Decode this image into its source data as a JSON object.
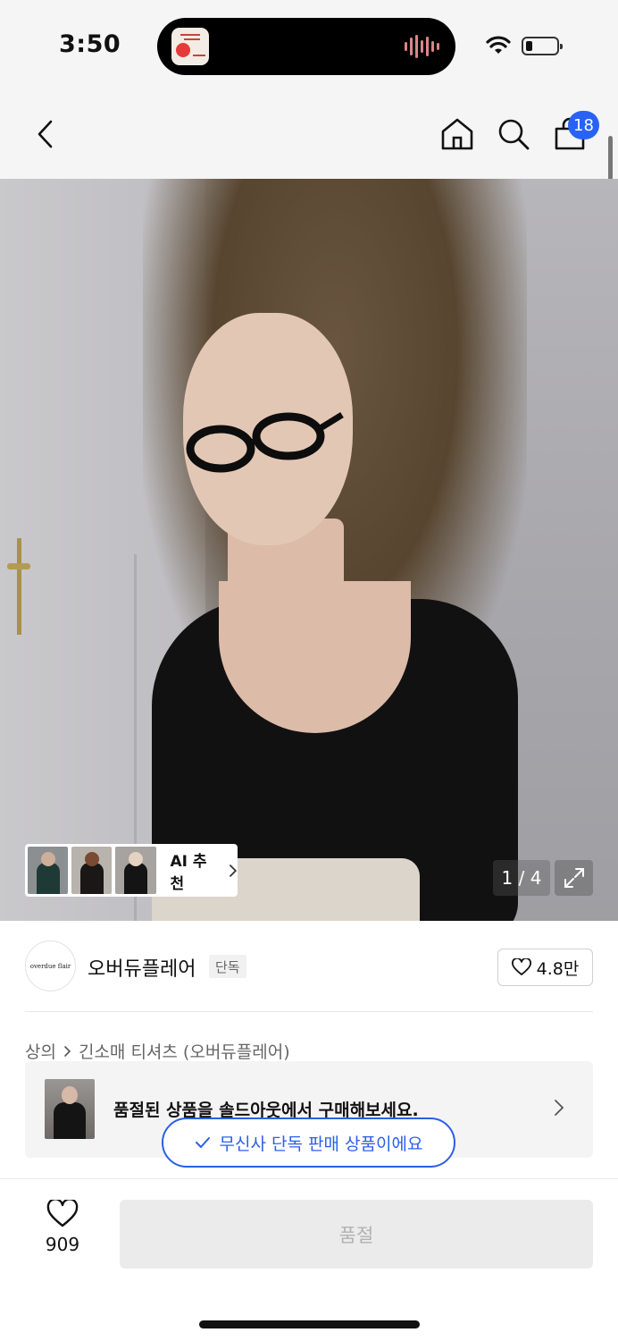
{
  "status_bar": {
    "time": "3:50"
  },
  "header": {
    "cart_count": "18"
  },
  "product_image": {
    "counter": "1 / 4",
    "ai_recommend_label": "AI 추천"
  },
  "brand": {
    "logo_text": "overdue flair",
    "name": "오버듀플레어",
    "tag": "단독",
    "likes": "4.8만"
  },
  "breadcrumb": {
    "category": "상의",
    "subcategory": "긴소매 티셔츠 (오버듀플레어)"
  },
  "soldout_banner": {
    "message": "품절된 상품을 솔드아웃에서 구매해보세요."
  },
  "exclusive_pill": {
    "label": "무신사 단독 판매 상품이에요"
  },
  "bottom_bar": {
    "wish_count": "909",
    "buy_button_label": "품절"
  },
  "colors": {
    "accent_blue": "#2b5fe8",
    "badge_blue": "#2863f5",
    "disabled_button": "#ebebeb"
  }
}
